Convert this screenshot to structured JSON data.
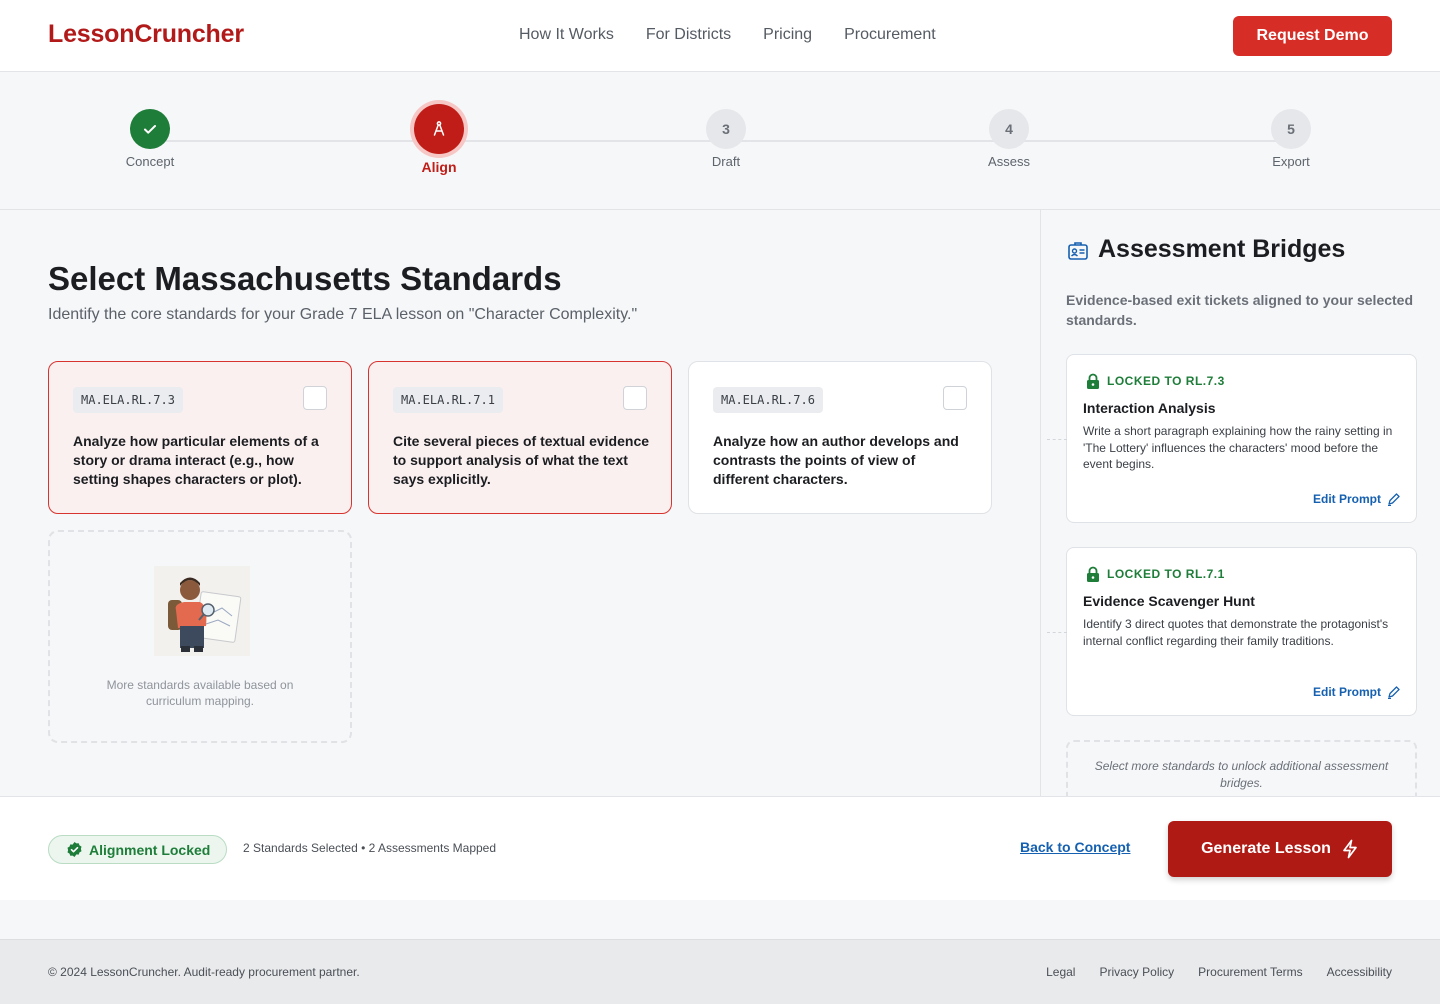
{
  "header": {
    "logo": "LessonCruncher",
    "nav": [
      "How It Works",
      "For Districts",
      "Pricing",
      "Procurement"
    ],
    "cta": "Request Demo"
  },
  "stepper": {
    "steps": [
      {
        "number": "1",
        "label": "Concept",
        "state": "done",
        "icon": "check-icon"
      },
      {
        "number": "2",
        "label": "Align",
        "state": "active",
        "icon": "compass-icon"
      },
      {
        "number": "3",
        "label": "Draft",
        "state": "pending"
      },
      {
        "number": "4",
        "label": "Assess",
        "state": "pending"
      },
      {
        "number": "5",
        "label": "Export",
        "state": "pending"
      }
    ]
  },
  "main": {
    "title": "Select Massachusetts Standards",
    "subtitle": "Identify the core standards for your Grade 7 ELA lesson on \"Character Complexity.\"",
    "standards": [
      {
        "code": "MA.ELA.RL.7.3",
        "text": "Analyze how particular elements of a story or drama interact (e.g., how setting shapes characters or plot).",
        "selected": true
      },
      {
        "code": "MA.ELA.RL.7.1",
        "text": "Cite several pieces of textual evidence to support analysis of what the text says explicitly.",
        "selected": true
      },
      {
        "code": "MA.ELA.RL.7.6",
        "text": "Analyze how an author develops and contrasts the points of view of different characters.",
        "selected": false
      }
    ],
    "placeholder_text": "More standards available based on curriculum mapping."
  },
  "sidebar": {
    "title": "Assessment Bridges",
    "subtitle": "Evidence-based exit tickets aligned to your selected standards.",
    "bridges": [
      {
        "lock_label": "LOCKED TO RL.7.3",
        "title": "Interaction Analysis",
        "description": "Write a short paragraph explaining how the rainy setting in 'The Lottery' influences the characters' mood before the event begins.",
        "edit_label": "Edit Prompt"
      },
      {
        "lock_label": "LOCKED TO RL.7.1",
        "title": "Evidence Scavenger Hunt",
        "description": "Identify 3 direct quotes that demonstrate the protagonist's internal conflict regarding their family traditions.",
        "edit_label": "Edit Prompt"
      }
    ],
    "more_text": "Select more standards to unlock additional assessment bridges."
  },
  "actionbar": {
    "status": "Alignment Locked",
    "summary": "2 Standards Selected • 2 Assessments Mapped",
    "back": "Back to Concept",
    "generate": "Generate Lesson"
  },
  "footer": {
    "copyright": "© 2024 LessonCruncher. Audit-ready procurement partner.",
    "links": [
      "Legal",
      "Privacy Policy",
      "Procurement Terms",
      "Accessibility"
    ]
  },
  "colors": {
    "brand": "#b21a1a",
    "accent_red": "#d62d26",
    "success_green": "#1e7d39",
    "link_blue": "#1560b0"
  }
}
